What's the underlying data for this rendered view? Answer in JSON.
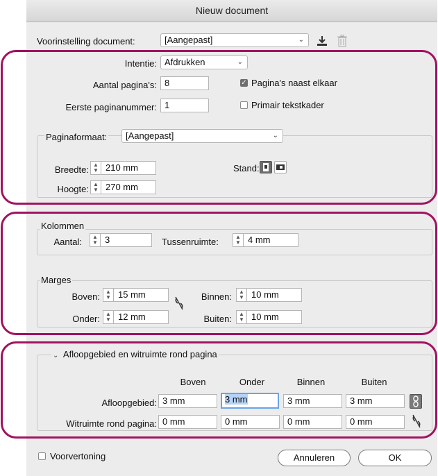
{
  "window": {
    "title": "Nieuw document"
  },
  "preset": {
    "label": "Voorinstelling document:",
    "value": "[Aangepast]"
  },
  "icons": {
    "save_preset": "download-icon",
    "delete_preset": "trash-icon"
  },
  "document": {
    "intent_label": "Intentie:",
    "intent_value": "Afdrukken",
    "pages_label": "Aantal pagina's:",
    "pages_value": "8",
    "first_page_label": "Eerste paginanummer:",
    "first_page_value": "1",
    "facing_pages_label": "Pagina's naast elkaar",
    "facing_pages_checked": true,
    "primary_frame_label": "Primair tekstkader",
    "primary_frame_checked": false
  },
  "page_size": {
    "label": "Paginaformaat:",
    "value": "[Aangepast]",
    "width_label": "Breedte:",
    "width_value": "210 mm",
    "height_label": "Hoogte:",
    "height_value": "270 mm",
    "orientation_label": "Stand:"
  },
  "columns": {
    "title": "Kolommen",
    "count_label": "Aantal:",
    "count_value": "3",
    "gutter_label": "Tussenruimte:",
    "gutter_value": "4 mm"
  },
  "margins": {
    "title": "Marges",
    "top_label": "Boven:",
    "top_value": "15 mm",
    "bottom_label": "Onder:",
    "bottom_value": "12 mm",
    "inside_label": "Binnen:",
    "inside_value": "10 mm",
    "outside_label": "Buiten:",
    "outside_value": "10 mm"
  },
  "bleed": {
    "title": "Afloopgebied en witruimte rond pagina",
    "col_top": "Boven",
    "col_bottom": "Onder",
    "col_inside": "Binnen",
    "col_outside": "Buiten",
    "bleed_label": "Afloopgebied:",
    "bleed_values": [
      "3 mm",
      "3 mm",
      "3 mm",
      "3 mm"
    ],
    "slug_label": "Witruimte rond pagina:",
    "slug_values": [
      "0 mm",
      "0 mm",
      "0 mm",
      "0 mm"
    ]
  },
  "footer": {
    "preview_label": "Voorvertoning",
    "preview_checked": false,
    "cancel_label": "Annuleren",
    "ok_label": "OK"
  },
  "colors": {
    "highlight": "#a2125f",
    "focus": "#6aa3e8"
  }
}
